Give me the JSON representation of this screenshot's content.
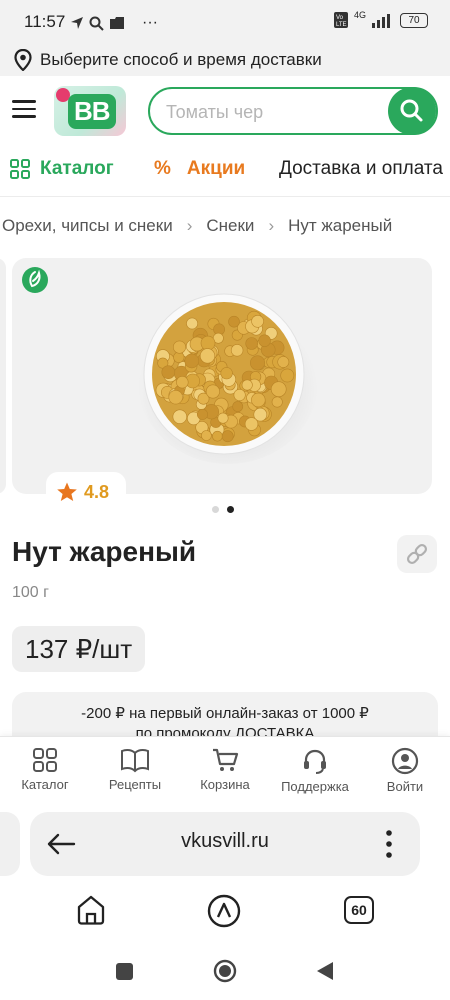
{
  "status_bar": {
    "time": "11:57",
    "dots": "···",
    "network": "4G",
    "battery": "70"
  },
  "delivery_bar": {
    "text": "Выберите способ и время доставки"
  },
  "header": {
    "logo_text": "BB",
    "search": {
      "placeholder": "Томаты чер"
    }
  },
  "nav": {
    "items": [
      {
        "label": "Каталог"
      },
      {
        "label": "Акции"
      },
      {
        "label": "Доставка и оплата"
      }
    ]
  },
  "breadcrumbs": [
    "Орехи, чипсы и снеки",
    "Снеки",
    "Нут жареный"
  ],
  "product": {
    "rating": "4.8",
    "title": "Нут жареный",
    "weight": "100 г",
    "price": "137 ₽/шт",
    "promo_line1": "-200 ₽ на первый онлайн-заказ от 1000 ₽",
    "promo_line2": "по промокоду ДОСТАВКА",
    "gallery_dots": 2,
    "gallery_active": 1
  },
  "bottom_nav": {
    "items": [
      {
        "label": "Каталог"
      },
      {
        "label": "Рецепты"
      },
      {
        "label": "Корзина"
      },
      {
        "label": "Поддержка"
      },
      {
        "label": "Войти"
      }
    ]
  },
  "browser": {
    "url": "vkusvill.ru",
    "tabs_count": "60"
  },
  "colors": {
    "accent_green": "#2aa85c",
    "promo_orange": "#e87a1f",
    "rating_yellow": "#e09a1f"
  }
}
